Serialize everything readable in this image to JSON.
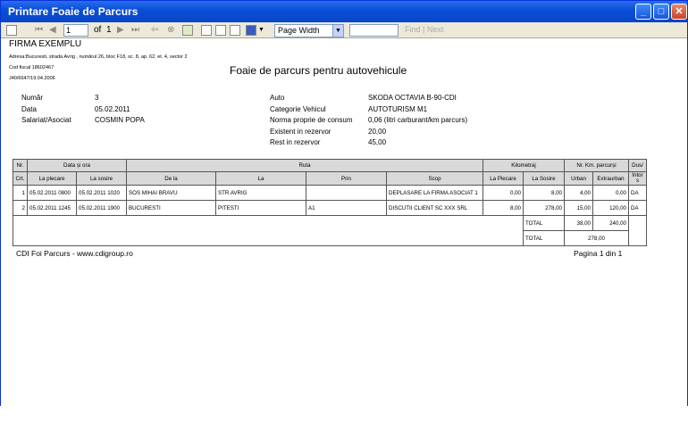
{
  "window": {
    "title": "Printare Foaie de Parcurs"
  },
  "toolbar": {
    "page": "1",
    "of_label": "of",
    "page_count": "1",
    "zoom": "Page Width",
    "find_next": "Find | Next"
  },
  "company": {
    "name": "FIRMA EXEMPLU",
    "address": "Adresa:Bucuresti, strada Avrig , numărul 26, bloc F18, sc. 8, ap. 62, et. 4, sector 2",
    "fiscal": "Cod fiscal 18602467",
    "reg": "J40/6647/19.04.2006"
  },
  "report_title": "Foaie de parcurs pentru autovehicule",
  "info_left": [
    {
      "label": "Număr",
      "value": "3"
    },
    {
      "label": "Data",
      "value": "05.02.2011"
    },
    {
      "label": "Salariat/Asociat",
      "value": "COSMIN POPA"
    }
  ],
  "info_right": [
    {
      "label": "Auto",
      "value": "SKODA OCTAVIA B-90-CDI"
    },
    {
      "label": "Categorie Vehicul",
      "value": "AUTOTURISM M1"
    },
    {
      "label": "Norma proprie de consum",
      "value": "0,06 (litri carburant/km parcurs)"
    },
    {
      "label": "Existent in rezervor",
      "value": "20,00"
    },
    {
      "label": "Rest in rezervor",
      "value": "45,00"
    }
  ],
  "table": {
    "h1": {
      "nr": "Nr.",
      "data": "Data și ora",
      "ruta": "Ruta",
      "km": "Kilometraj",
      "kmp": "Nr. Km. parcurși",
      "dus": "Dus/"
    },
    "h2": [
      "Crt.",
      "La plecare",
      "La sosire",
      "De la",
      "La",
      "Prin",
      "Scop",
      "La Plecare",
      "La Sosire",
      "Urban",
      "Extraurban",
      "Întor s"
    ],
    "rows": [
      [
        "1",
        "05.02.2011 0800",
        "05.02.2011 1020",
        "SOS MIHAI BRAVU",
        "STR AVRIG",
        "",
        "DEPLASARE LA FIRMA ASOCIAT 1",
        "0,00",
        "8,00",
        "4,00",
        "0,00",
        "DA"
      ],
      [
        "2",
        "05.02.2011 1245",
        "05.02.2011 1900",
        "BUCURESTI",
        "PITESTI",
        "A1",
        "DISCUTII CLIENT SC XXX SRL",
        "8,00",
        "278,00",
        "15,00",
        "120,00",
        "DA"
      ]
    ],
    "total1": {
      "label": "TOTAL",
      "urban": "38,00",
      "extra": "240,00"
    },
    "total2": {
      "label": "TOTAL",
      "value": "278,00"
    }
  },
  "footer": {
    "left": "CDI Foi Parcurs - www.cdigroup.ro",
    "right": "Pagina 1 din 1"
  }
}
